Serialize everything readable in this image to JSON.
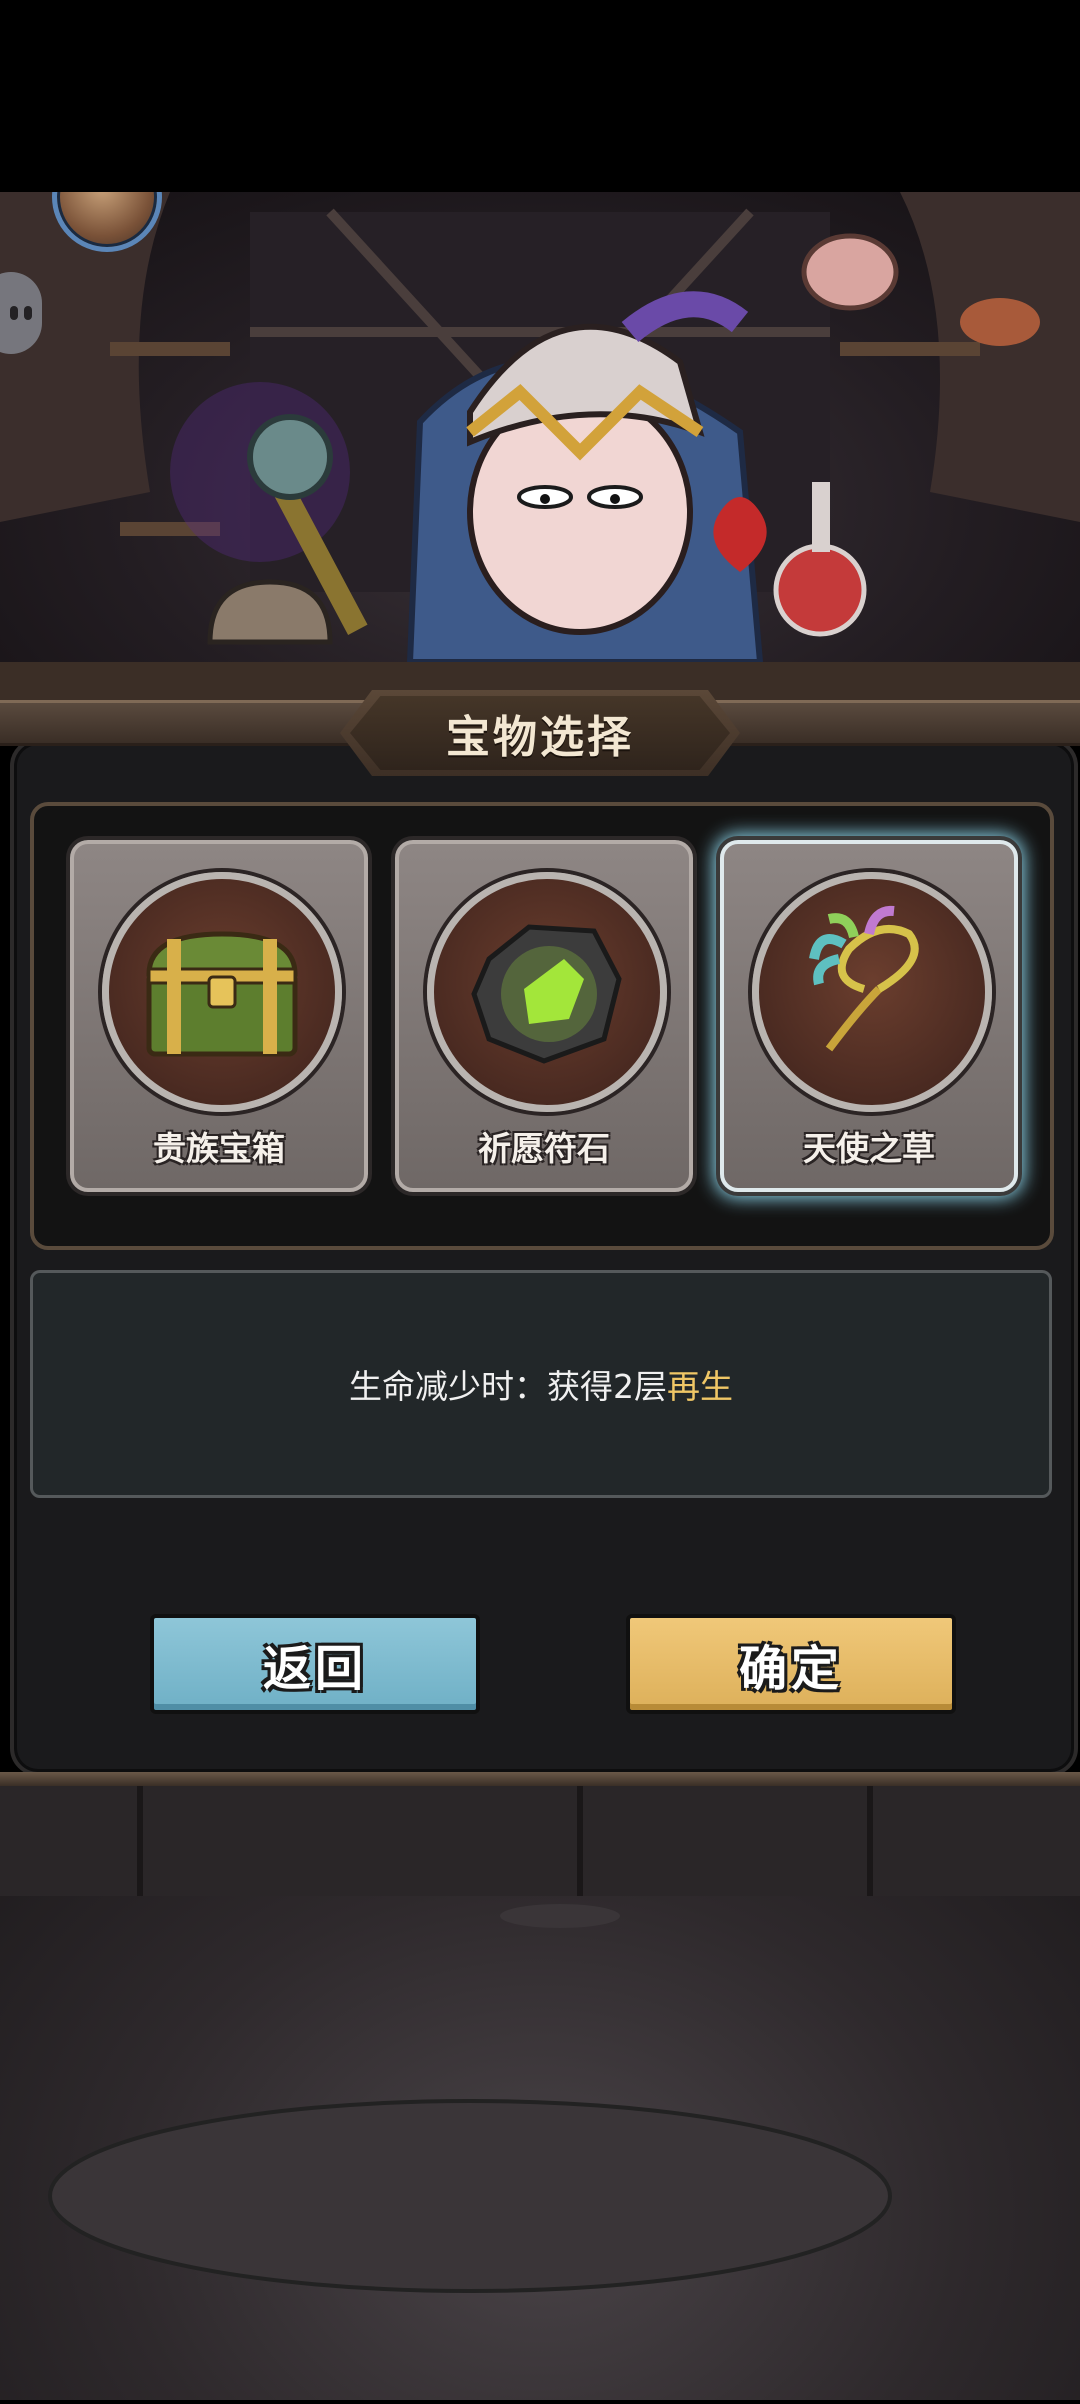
{
  "screen": {
    "title": "宝物选择"
  },
  "treasures": [
    {
      "name": "贵族宝箱",
      "icon": "treasure-chest-icon",
      "selected": false
    },
    {
      "name": "祈愿符石",
      "icon": "glowing-rune-stone-icon",
      "selected": false
    },
    {
      "name": "天使之草",
      "icon": "angel-herb-icon",
      "selected": true
    }
  ],
  "description": {
    "prefix": "生命减少时：获得2层",
    "highlight": "再生"
  },
  "buttons": {
    "back": "返回",
    "confirm": "确定"
  },
  "colors": {
    "highlight": "#f0c766",
    "back_button": "#7fbccf",
    "confirm_button": "#e8bd6a",
    "selected_glow": "#8fd8ee"
  }
}
